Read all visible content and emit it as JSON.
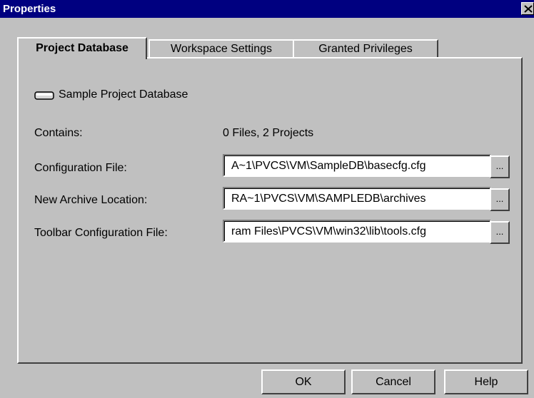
{
  "window": {
    "title": "Properties",
    "close_glyph": "close-icon"
  },
  "tabs": [
    {
      "label": "Project Database",
      "active": true
    },
    {
      "label": "Workspace Settings",
      "active": false
    },
    {
      "label": "Granted Privileges",
      "active": false
    }
  ],
  "project_database": {
    "icon": "database-icon",
    "name": "Sample Project Database",
    "contains_label": "Contains:",
    "contains_value": "0 Files, 2 Projects",
    "fields": [
      {
        "label": "Configuration File:",
        "value": "A~1\\PVCS\\VM\\SampleDB\\basecfg.cfg",
        "browse": "..."
      },
      {
        "label": "New Archive Location:",
        "value": "RA~1\\PVCS\\VM\\SAMPLEDB\\archives",
        "browse": "..."
      },
      {
        "label": "Toolbar Configuration File:",
        "value": "ram Files\\PVCS\\VM\\win32\\lib\\tools.cfg",
        "browse": "..."
      }
    ]
  },
  "buttons": {
    "ok": "OK",
    "cancel": "Cancel",
    "help": "Help"
  },
  "colors": {
    "titlebar": "#000080",
    "face": "#c0c0c0"
  }
}
